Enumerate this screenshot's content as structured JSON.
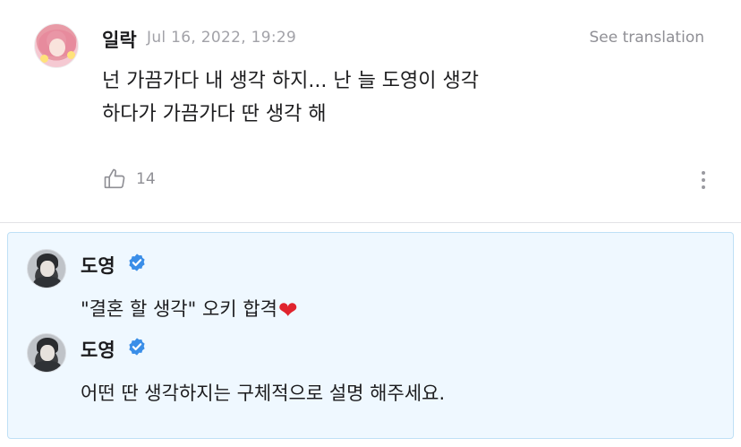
{
  "comment": {
    "username": "일락",
    "timestamp": "Jul 16, 2022, 19:29",
    "see_translation": "See translation",
    "lines": [
      "넌 가끔가다 내 생각 하지... 난 늘 도영이 생각",
      "하다가 가끔가다 딴 생각 해"
    ],
    "like_count": "14"
  },
  "replies": [
    {
      "name": "도영",
      "text": "\"결혼 할 생각\" 오키 합격",
      "emoji": "❤"
    },
    {
      "name": "도영",
      "text": "어떤 딴 생각하지는 구체적으로 설명 해주세요."
    }
  ],
  "colors": {
    "verified": "#3a8ee8",
    "reply_bg": "#eff8ff",
    "reply_border": "#bfe0f6",
    "heart": "#e0242e"
  }
}
